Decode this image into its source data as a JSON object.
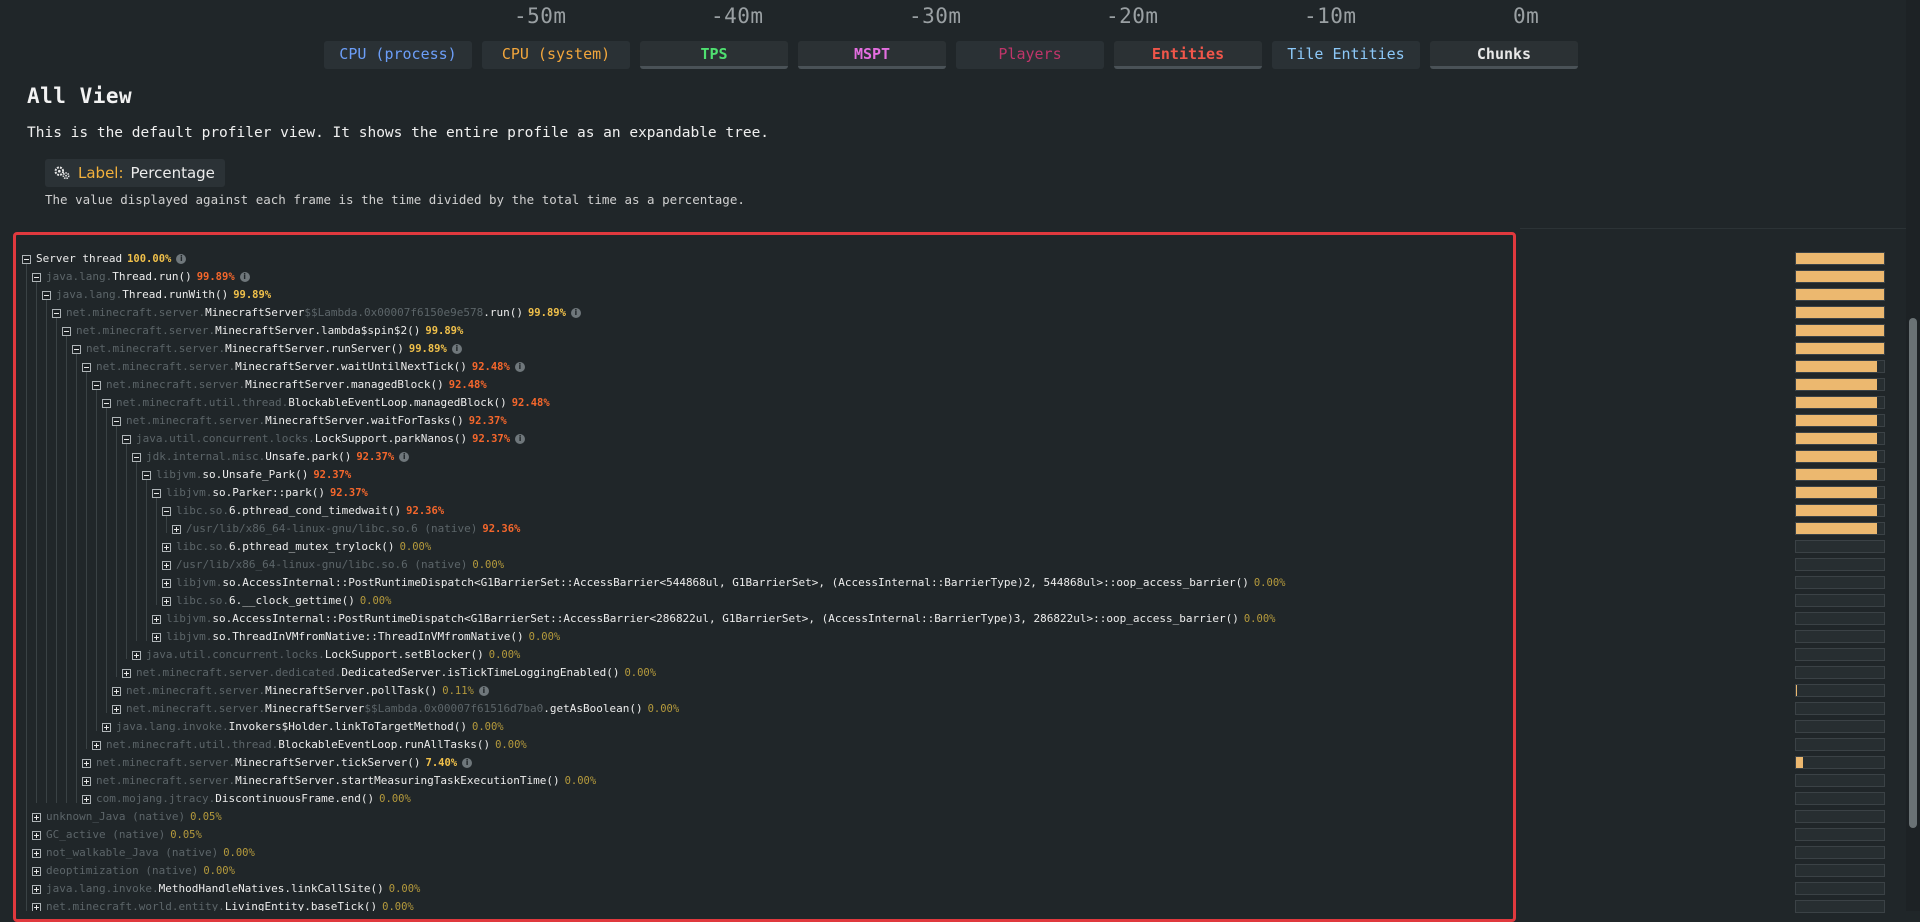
{
  "timeline": {
    "labels": [
      "-50m",
      "-40m",
      "-30m",
      "-20m",
      "-10m",
      "0m"
    ]
  },
  "metrics": [
    {
      "label": "CPU (process)",
      "color": "#6c9ef8",
      "active": false,
      "bold": false
    },
    {
      "label": "CPU (system)",
      "color": "#f2a63c",
      "active": false,
      "bold": false
    },
    {
      "label": "TPS",
      "color": "#4fe070",
      "active": true,
      "bold": true
    },
    {
      "label": "MSPT",
      "color": "#e46ee0",
      "active": true,
      "bold": true
    },
    {
      "label": "Players",
      "color": "#c0356a",
      "active": false,
      "bold": false
    },
    {
      "label": "Entities",
      "color": "#f0564a",
      "active": true,
      "bold": true
    },
    {
      "label": "Tile Entities",
      "color": "#8cc8f8",
      "active": false,
      "bold": false
    },
    {
      "label": "Chunks",
      "color": "#e8e8e8",
      "active": true,
      "bold": true
    }
  ],
  "view": {
    "title": "All View",
    "description": "This is the default profiler view. It shows the entire profile as an expandable tree.",
    "label_key": "Label:",
    "label_value": "Percentage",
    "label_note": "The value displayed against each frame is the time divided by the total time as a percentage."
  },
  "tree": [
    {
      "depth": 0,
      "pkg": "",
      "name": "Server thread",
      "suffix": "",
      "pct": "100.00%",
      "cls": "hi",
      "info": true,
      "bar": 1.0
    },
    {
      "depth": 1,
      "pkg": "java.lang.",
      "name": "Thread.run()",
      "suffix": "",
      "pct": "99.89%",
      "cls": "org",
      "info": true,
      "bar": 0.999
    },
    {
      "depth": 2,
      "pkg": "java.lang.",
      "name": "Thread.runWith()",
      "suffix": "",
      "pct": "99.89%",
      "cls": "hi",
      "info": false,
      "bar": 0.999
    },
    {
      "depth": 3,
      "pkg": "net.minecraft.server.",
      "name": "MinecraftServer",
      "suffix": "$$Lambda.0x00007f6150e9e578",
      "name2": ".run()",
      "pct": "99.89%",
      "cls": "hi",
      "info": true,
      "bar": 0.999
    },
    {
      "depth": 4,
      "pkg": "net.minecraft.server.",
      "name": "MinecraftServer.lambda$spin$2()",
      "suffix": "",
      "pct": "99.89%",
      "cls": "hi",
      "info": false,
      "bar": 0.999
    },
    {
      "depth": 5,
      "pkg": "net.minecraft.server.",
      "name": "MinecraftServer.runServer()",
      "suffix": "",
      "pct": "99.89%",
      "cls": "hi",
      "info": true,
      "bar": 0.999
    },
    {
      "depth": 6,
      "pkg": "net.minecraft.server.",
      "name": "MinecraftServer.waitUntilNextTick()",
      "suffix": "",
      "pct": "92.48%",
      "cls": "org",
      "info": true,
      "bar": 0.925
    },
    {
      "depth": 7,
      "pkg": "net.minecraft.server.",
      "name": "MinecraftServer.managedBlock()",
      "suffix": "",
      "pct": "92.48%",
      "cls": "org",
      "info": false,
      "bar": 0.925
    },
    {
      "depth": 8,
      "pkg": "net.minecraft.util.thread.",
      "name": "BlockableEventLoop.managedBlock()",
      "suffix": "",
      "pct": "92.48%",
      "cls": "org",
      "info": false,
      "bar": 0.925
    },
    {
      "depth": 9,
      "pkg": "net.minecraft.server.",
      "name": "MinecraftServer.waitForTasks()",
      "suffix": "",
      "pct": "92.37%",
      "cls": "org",
      "info": false,
      "bar": 0.924
    },
    {
      "depth": 10,
      "pkg": "java.util.concurrent.locks.",
      "name": "LockSupport.parkNanos()",
      "suffix": "",
      "pct": "92.37%",
      "cls": "org",
      "info": true,
      "bar": 0.924
    },
    {
      "depth": 11,
      "pkg": "jdk.internal.misc.",
      "name": "Unsafe.park()",
      "suffix": "",
      "pct": "92.37%",
      "cls": "org",
      "info": true,
      "bar": 0.924
    },
    {
      "depth": 12,
      "pkg": "libjvm.",
      "name": "so.Unsafe_Park()",
      "suffix": "",
      "pct": "92.37%",
      "cls": "org",
      "info": false,
      "bar": 0.924
    },
    {
      "depth": 13,
      "pkg": "libjvm.",
      "name": "so.Parker::park()",
      "suffix": "",
      "pct": "92.37%",
      "cls": "org",
      "info": false,
      "bar": 0.924
    },
    {
      "depth": 14,
      "pkg": "libc.so.",
      "name": "6.pthread_cond_timedwait()",
      "suffix": "",
      "pct": "92.36%",
      "cls": "org",
      "info": false,
      "bar": 0.924
    },
    {
      "depth": 15,
      "pkg": "/usr/lib/x86_64-linux-gnu/libc.so.6 (native)",
      "name": "",
      "suffix": "",
      "pct": "92.36%",
      "cls": "org",
      "info": false,
      "bar": 0.924
    },
    {
      "depth": 14,
      "pkg": "libc.so.",
      "name": "6.pthread_mutex_trylock()",
      "suffix": "",
      "pct": "0.00%",
      "cls": "lo",
      "info": false,
      "bar": 0
    },
    {
      "depth": 14,
      "pkg": "/usr/lib/x86_64-linux-gnu/libc.so.6 (native)",
      "name": "",
      "suffix": "",
      "pct": "0.00%",
      "cls": "lo",
      "info": false,
      "bar": 0
    },
    {
      "depth": 14,
      "pkg": "libjvm.",
      "name": "so.AccessInternal::PostRuntimeDispatch<G1BarrierSet::AccessBarrier<544868ul, G1BarrierSet>, (AccessInternal::BarrierType)2, 544868ul>::oop_access_barrier()",
      "suffix": "",
      "pct": "0.00%",
      "cls": "lo",
      "info": false,
      "bar": 0
    },
    {
      "depth": 14,
      "pkg": "libc.so.",
      "name": "6.__clock_gettime()",
      "suffix": "",
      "pct": "0.00%",
      "cls": "lo",
      "info": false,
      "bar": 0
    },
    {
      "depth": 13,
      "pkg": "libjvm.",
      "name": "so.AccessInternal::PostRuntimeDispatch<G1BarrierSet::AccessBarrier<286822ul, G1BarrierSet>, (AccessInternal::BarrierType)3, 286822ul>::oop_access_barrier()",
      "suffix": "",
      "pct": "0.00%",
      "cls": "lo",
      "info": false,
      "bar": 0
    },
    {
      "depth": 13,
      "pkg": "libjvm.",
      "name": "so.ThreadInVMfromNative::ThreadInVMfromNative()",
      "suffix": "",
      "pct": "0.00%",
      "cls": "lo",
      "info": false,
      "bar": 0
    },
    {
      "depth": 11,
      "pkg": "java.util.concurrent.locks.",
      "name": "LockSupport.setBlocker()",
      "suffix": "",
      "pct": "0.00%",
      "cls": "lo",
      "info": false,
      "bar": 0
    },
    {
      "depth": 10,
      "pkg": "net.minecraft.server.dedicated.",
      "name": "DedicatedServer.isTickTimeLoggingEnabled()",
      "suffix": "",
      "pct": "0.00%",
      "cls": "lo",
      "info": false,
      "bar": 0
    },
    {
      "depth": 9,
      "pkg": "net.minecraft.server.",
      "name": "MinecraftServer.pollTask()",
      "suffix": "",
      "pct": "0.11%",
      "cls": "lo",
      "info": true,
      "bar": 0.011
    },
    {
      "depth": 9,
      "pkg": "net.minecraft.server.",
      "name": "MinecraftServer",
      "suffix": "$$Lambda.0x00007f61516d7ba0",
      "name2": ".getAsBoolean()",
      "pct": "0.00%",
      "cls": "lo",
      "info": false,
      "bar": 0
    },
    {
      "depth": 8,
      "pkg": "java.lang.invoke.",
      "name": "Invokers$Holder.linkToTargetMethod()",
      "suffix": "",
      "pct": "0.00%",
      "cls": "lo",
      "info": false,
      "bar": 0
    },
    {
      "depth": 7,
      "pkg": "net.minecraft.util.thread.",
      "name": "BlockableEventLoop.runAllTasks()",
      "suffix": "",
      "pct": "0.00%",
      "cls": "lo",
      "info": false,
      "bar": 0
    },
    {
      "depth": 6,
      "pkg": "net.minecraft.server.",
      "name": "MinecraftServer.tickServer()",
      "suffix": "",
      "pct": "7.40%",
      "cls": "hi",
      "info": true,
      "bar": 0.074
    },
    {
      "depth": 6,
      "pkg": "net.minecraft.server.",
      "name": "MinecraftServer.startMeasuringTaskExecutionTime()",
      "suffix": "",
      "pct": "0.00%",
      "cls": "lo",
      "info": false,
      "bar": 0
    },
    {
      "depth": 6,
      "pkg": "com.mojang.jtracy.",
      "name": "DiscontinuousFrame.end()",
      "suffix": "",
      "pct": "0.00%",
      "cls": "lo",
      "info": false,
      "bar": 0
    },
    {
      "depth": 1,
      "pkg": "unknown_Java (native)",
      "name": "",
      "suffix": "",
      "pct": "0.05%",
      "cls": "lo",
      "info": false,
      "bar": 0
    },
    {
      "depth": 1,
      "pkg": "GC_active (native)",
      "name": "",
      "suffix": "",
      "pct": "0.05%",
      "cls": "lo",
      "info": false,
      "bar": 0
    },
    {
      "depth": 1,
      "pkg": "not_walkable_Java (native)",
      "name": "",
      "suffix": "",
      "pct": "0.00%",
      "cls": "lo",
      "info": false,
      "bar": 0
    },
    {
      "depth": 1,
      "pkg": "deoptimization (native)",
      "name": "",
      "suffix": "",
      "pct": "0.00%",
      "cls": "lo",
      "info": false,
      "bar": 0
    },
    {
      "depth": 1,
      "pkg": "java.lang.invoke.",
      "name": "MethodHandleNatives.linkCallSite()",
      "suffix": "",
      "pct": "0.00%",
      "cls": "lo",
      "info": false,
      "bar": 0
    },
    {
      "depth": 1,
      "pkg": "net.minecraft.world.entity.",
      "name": "LivingEntity.baseTick()",
      "suffix": "",
      "pct": "0.00%",
      "cls": "lo",
      "info": false,
      "bar": 0
    }
  ]
}
